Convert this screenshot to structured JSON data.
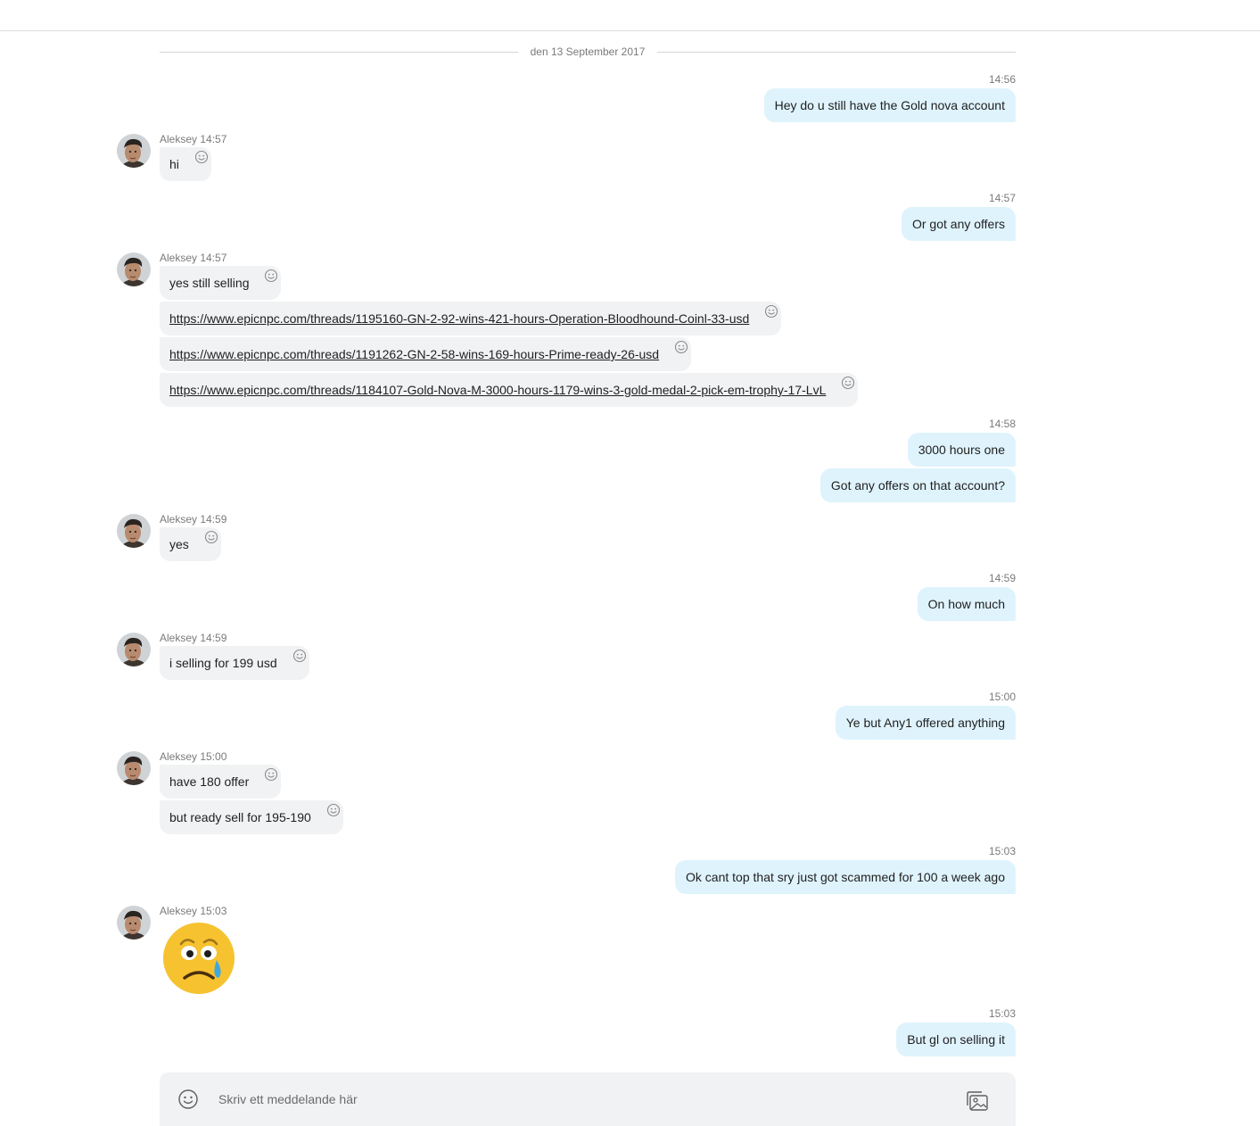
{
  "date_separator": "den 13 September 2017",
  "contact_name": "Aleksey",
  "messages": {
    "m1": {
      "time": "14:56",
      "text": "Hey do u still have the Gold nova account"
    },
    "m2": {
      "header": "Aleksey 14:57",
      "text": "hi"
    },
    "m3": {
      "time": "14:57",
      "text": "Or got any offers"
    },
    "m4": {
      "header": "Aleksey 14:57",
      "text": "yes still selling",
      "link1": "https://www.epicnpc.com/threads/1195160-GN-2-92-wins-421-hours-Operation-Bloodhound-Coinl-33-usd",
      "link2": "https://www.epicnpc.com/threads/1191262-GN-2-58-wins-169-hours-Prime-ready-26-usd",
      "link3": "https://www.epicnpc.com/threads/1184107-Gold-Nova-M-3000-hours-1179-wins-3-gold-medal-2-pick-em-trophy-17-LvL"
    },
    "m5": {
      "time": "14:58",
      "text1": "3000 hours one",
      "text2": "Got any offers on that account?"
    },
    "m6": {
      "header": "Aleksey 14:59",
      "text": "yes"
    },
    "m7": {
      "time": "14:59",
      "text": "On how much"
    },
    "m8": {
      "header": "Aleksey 14:59",
      "text": "i selling for 199 usd"
    },
    "m9": {
      "time": "15:00",
      "text": "Ye but Any1 offered anything"
    },
    "m10": {
      "header": "Aleksey 15:00",
      "text1": "have 180 offer",
      "text2": "but ready sell for 195-190"
    },
    "m11": {
      "time": "15:03",
      "text": "Ok cant top that sry just got scammed for 100 a week ago"
    },
    "m12": {
      "header": "Aleksey 15:03",
      "emoji": "crying-face-emoji"
    },
    "m13": {
      "time": "15:03",
      "text": "But gl on selling it"
    }
  },
  "composer": {
    "placeholder": "Skriv ett meddelande här"
  },
  "colors": {
    "outgoing_bubble": "#dff3fd",
    "incoming_bubble": "#f1f2f4",
    "meta_text": "#7a7a7a"
  }
}
